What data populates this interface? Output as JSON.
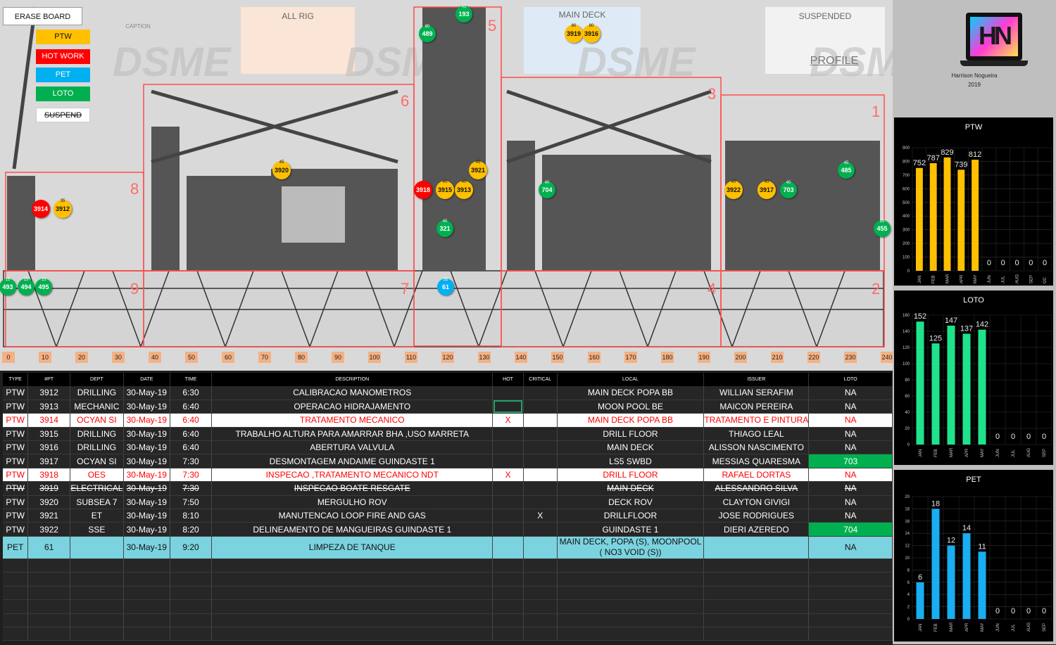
{
  "board": {
    "erase_button": "ERASE BOARD",
    "caption_label": "CAPTION",
    "legend": [
      {
        "label": "PTW",
        "color": "#ffc000",
        "text_color": "#111"
      },
      {
        "label": "HOT WORK",
        "color": "#ff0000",
        "text_color": "#fff"
      },
      {
        "label": "PET",
        "color": "#00b0f0",
        "text_color": "#fff"
      },
      {
        "label": "LOTO",
        "color": "#00b050",
        "text_color": "#fff"
      },
      {
        "label": "SUSPEND",
        "color": "#ffffff",
        "text_color": "#111"
      }
    ],
    "zones": {
      "all_rig": "ALL RIG",
      "main_deck": "MAIN DECK",
      "suspended": "SUSPENDED"
    },
    "profile_label": "PROFILE",
    "watermark": "DSME",
    "area_numbers": [
      "1",
      "2",
      "3",
      "4",
      "5",
      "6",
      "7",
      "8",
      "9"
    ],
    "ruler": [
      "0",
      "10",
      "20",
      "30",
      "40",
      "50",
      "60",
      "70",
      "80",
      "90",
      "100",
      "110",
      "120",
      "130",
      "140",
      "150",
      "160",
      "170",
      "180",
      "190",
      "200",
      "210",
      "220",
      "230",
      "240"
    ],
    "markers": [
      {
        "id": "193",
        "type": "g",
        "sub": "45"
      },
      {
        "id": "489",
        "type": "g",
        "sub": "80"
      },
      {
        "id": "3919",
        "type": "y",
        "sub": "80"
      },
      {
        "id": "3916",
        "type": "y",
        "sub": "80"
      },
      {
        "id": "3920",
        "type": "y",
        "sub": "45"
      },
      {
        "id": "3921",
        "type": "y",
        "sub": "45"
      },
      {
        "id": "3918",
        "type": "r",
        "sub": ""
      },
      {
        "id": "3915",
        "type": "y",
        "sub": "40"
      },
      {
        "id": "3913",
        "type": "y",
        "sub": "40"
      },
      {
        "id": "704",
        "type": "g",
        "sub": "40"
      },
      {
        "id": "3914",
        "type": "r",
        "sub": ""
      },
      {
        "id": "3912",
        "type": "y",
        "sub": "35"
      },
      {
        "id": "321",
        "type": "g",
        "sub": "45"
      },
      {
        "id": "3922",
        "type": "y",
        "sub": "40"
      },
      {
        "id": "3917",
        "type": "y",
        "sub": "40"
      },
      {
        "id": "703",
        "type": "g",
        "sub": "40"
      },
      {
        "id": "485",
        "type": "g",
        "sub": "45"
      },
      {
        "id": "455",
        "type": "g",
        "sub": "30"
      },
      {
        "id": "493",
        "type": "g",
        "sub": "15"
      },
      {
        "id": "494",
        "type": "g",
        "sub": "15"
      },
      {
        "id": "495",
        "type": "g",
        "sub": "15"
      },
      {
        "id": "61",
        "type": "b",
        "sub": "35"
      }
    ]
  },
  "table": {
    "headers": [
      "TYPE",
      "#PT",
      "DEPT",
      "DATE",
      "TIME",
      "DESCRIPTION",
      "HOT",
      "CRITICAL",
      "LOCAL",
      "ISSUER",
      "LOTO"
    ],
    "rows": [
      {
        "style": "dark",
        "cells": [
          "PTW",
          "3912",
          "DRILLING",
          "30-May-19",
          "6:30",
          "CALIBRACAO MANOMETROS",
          "",
          "",
          "MAIN DECK POPA BB",
          "WILLIAN SERAFIM",
          "NA"
        ]
      },
      {
        "style": "dark",
        "cells": [
          "PTW",
          "3913",
          "MECHANIC",
          "30-May-19",
          "6:40",
          "OPERACAO HIDRAJAMENTO",
          "",
          "",
          "MOON POOL BE",
          "MAICON PEREIRA",
          "NA"
        ]
      },
      {
        "style": "white",
        "cells": [
          "PTW",
          "3914",
          "OCYAN SI",
          "30-May-19",
          "6:40",
          "TRATAMENTO MECANICO",
          "X",
          "",
          "MAIN DECK POPA BB",
          "TRATAMENTO E PINTURA",
          "NA"
        ]
      },
      {
        "style": "dark",
        "cells": [
          "PTW",
          "3915",
          "DRILLING",
          "30-May-19",
          "6:40",
          "TRABALHO ALTURA PARA AMARRAR BHA ,USO MARRETA",
          "",
          "",
          "DRILL FLOOR",
          "THIAGO LEAL",
          "NA"
        ]
      },
      {
        "style": "dark",
        "cells": [
          "PTW",
          "3916",
          "DRILLING",
          "30-May-19",
          "6:40",
          "ABERTURA VALVULA",
          "",
          "",
          "MAIN DECK",
          "ALISSON NASCIMENTO",
          "NA"
        ]
      },
      {
        "style": "dark",
        "loto_green": true,
        "cells": [
          "PTW",
          "3917",
          "OCYAN SI",
          "30-May-19",
          "7:30",
          "DESMONTAGEM ANDAIME GUINDASTE 1",
          "",
          "",
          "LS5 SWBD",
          "MESSIAS QUARESMA",
          "703"
        ]
      },
      {
        "style": "white",
        "cells": [
          "PTW",
          "3918",
          "OES",
          "30-May-19",
          "7:30",
          "INSPECAO ,TRATAMENTO MECANICO NDT",
          "X",
          "",
          "DRILL FLOOR",
          "RAFAEL DORTAS",
          "NA"
        ]
      },
      {
        "style": "strike",
        "cells": [
          "PTW",
          "3919",
          "ELECTRICAL",
          "30-May-19",
          "7:30",
          "INSPECAO BOATE RESGATE",
          "",
          "",
          "MAIN DECK",
          "ALESSANDRO SILVA",
          "NA"
        ]
      },
      {
        "style": "dark",
        "cells": [
          "PTW",
          "3920",
          "SUBSEA 7",
          "30-May-19",
          "7:50",
          "MERGULHO ROV",
          "",
          "",
          "DECK ROV",
          "CLAYTON GIVIGI",
          "NA"
        ]
      },
      {
        "style": "dark",
        "cells": [
          "PTW",
          "3921",
          "ET",
          "30-May-19",
          "8:10",
          "MANUTENCAO LOOP  FIRE AND GAS",
          "",
          "X",
          "DRILLFLOOR",
          "JOSE RODRIGUES",
          "NA"
        ]
      },
      {
        "style": "dark",
        "loto_green": true,
        "cells": [
          "PTW",
          "3922",
          "SSE",
          "30-May-19",
          "8:20",
          "DELINEAMENTO DE MANGUEIRAS GUINDASTE 1",
          "",
          "",
          "GUINDASTE 1",
          "DIERI AZEREDO",
          "704"
        ]
      },
      {
        "style": "pet",
        "cells": [
          "PET",
          "61",
          "",
          "30-May-19",
          "9:20",
          "LIMPEZA DE TANQUE",
          "",
          "",
          "MAIN DECK, POPA (S), MOONPOOL ( NO3 VOID (S))",
          "",
          "NA"
        ]
      }
    ],
    "empty_rows": 6
  },
  "side": {
    "logo_letters": "HN",
    "author": "Harrison Nogueira",
    "year": "2019"
  },
  "chart_data": [
    {
      "type": "bar",
      "title": "PTW",
      "color": "#ffc000",
      "categories": [
        "JAN",
        "FEB",
        "MAR",
        "APR",
        "MAY",
        "JUN",
        "JUL",
        "AUG",
        "SEP",
        "OC"
      ],
      "values": [
        752,
        787,
        829,
        739,
        812,
        0,
        0,
        0,
        0,
        0
      ],
      "ylim": [
        0,
        900
      ],
      "yticks": [
        0,
        100,
        200,
        300,
        400,
        500,
        600,
        700,
        800,
        900
      ]
    },
    {
      "type": "bar",
      "title": "LOTO",
      "color": "#1fe38c",
      "categories": [
        "JAN",
        "FEB",
        "MAR",
        "APR",
        "MAY",
        "JUN",
        "JUL",
        "AUG",
        "SEP"
      ],
      "values": [
        152,
        125,
        147,
        137,
        142,
        0,
        0,
        0,
        0
      ],
      "ylim": [
        0,
        160
      ],
      "yticks": [
        0,
        20,
        40,
        60,
        80,
        100,
        120,
        140,
        160
      ]
    },
    {
      "type": "bar",
      "title": "PET",
      "color": "#19aef0",
      "categories": [
        "JAN",
        "FEB",
        "MAR",
        "APR",
        "MAY",
        "JUN",
        "JUL",
        "AUG",
        "SEP"
      ],
      "values": [
        6,
        18,
        12,
        14,
        11,
        0,
        0,
        0,
        0
      ],
      "ylim": [
        0,
        20
      ],
      "yticks": [
        0,
        2,
        4,
        6,
        8,
        10,
        12,
        14,
        16,
        18,
        20
      ]
    }
  ]
}
